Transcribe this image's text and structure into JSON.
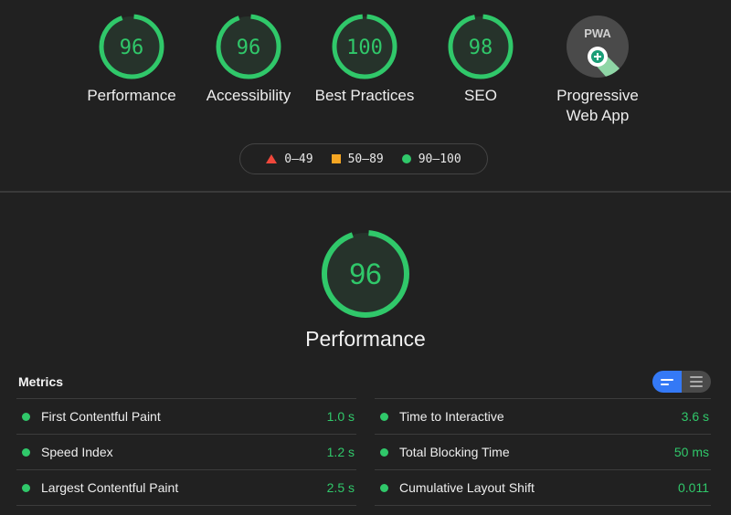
{
  "categories": [
    {
      "name": "Performance",
      "score": 96
    },
    {
      "name": "Accessibility",
      "score": 96
    },
    {
      "name": "Best Practices",
      "score": 100
    },
    {
      "name": "SEO",
      "score": 98
    },
    {
      "name": "Progressive Web App",
      "line1": "Progressive",
      "line2": "Web App",
      "badge": "PWA",
      "icon": "pwa-badge-icon"
    }
  ],
  "legend": [
    {
      "range": "0–49",
      "shape": "triangle",
      "color": "#f0473b"
    },
    {
      "range": "50–89",
      "shape": "square",
      "color": "#f5a623"
    },
    {
      "range": "90–100",
      "shape": "circle",
      "color": "#30c86a"
    }
  ],
  "main": {
    "score": 96,
    "label": "Performance"
  },
  "metrics": {
    "title": "Metrics",
    "left": [
      {
        "name": "First Contentful Paint",
        "value": "1.0 s"
      },
      {
        "name": "Speed Index",
        "value": "1.2 s"
      },
      {
        "name": "Largest Contentful Paint",
        "value": "2.5 s"
      }
    ],
    "right": [
      {
        "name": "Time to Interactive",
        "value": "3.6 s"
      },
      {
        "name": "Total Blocking Time",
        "value": "50 ms"
      },
      {
        "name": "Cumulative Layout Shift",
        "value": "0.011"
      }
    ]
  },
  "colors": {
    "pass": "#30c86a",
    "average": "#f5a623",
    "fail": "#f0473b",
    "toggle_active": "#3479f6"
  }
}
